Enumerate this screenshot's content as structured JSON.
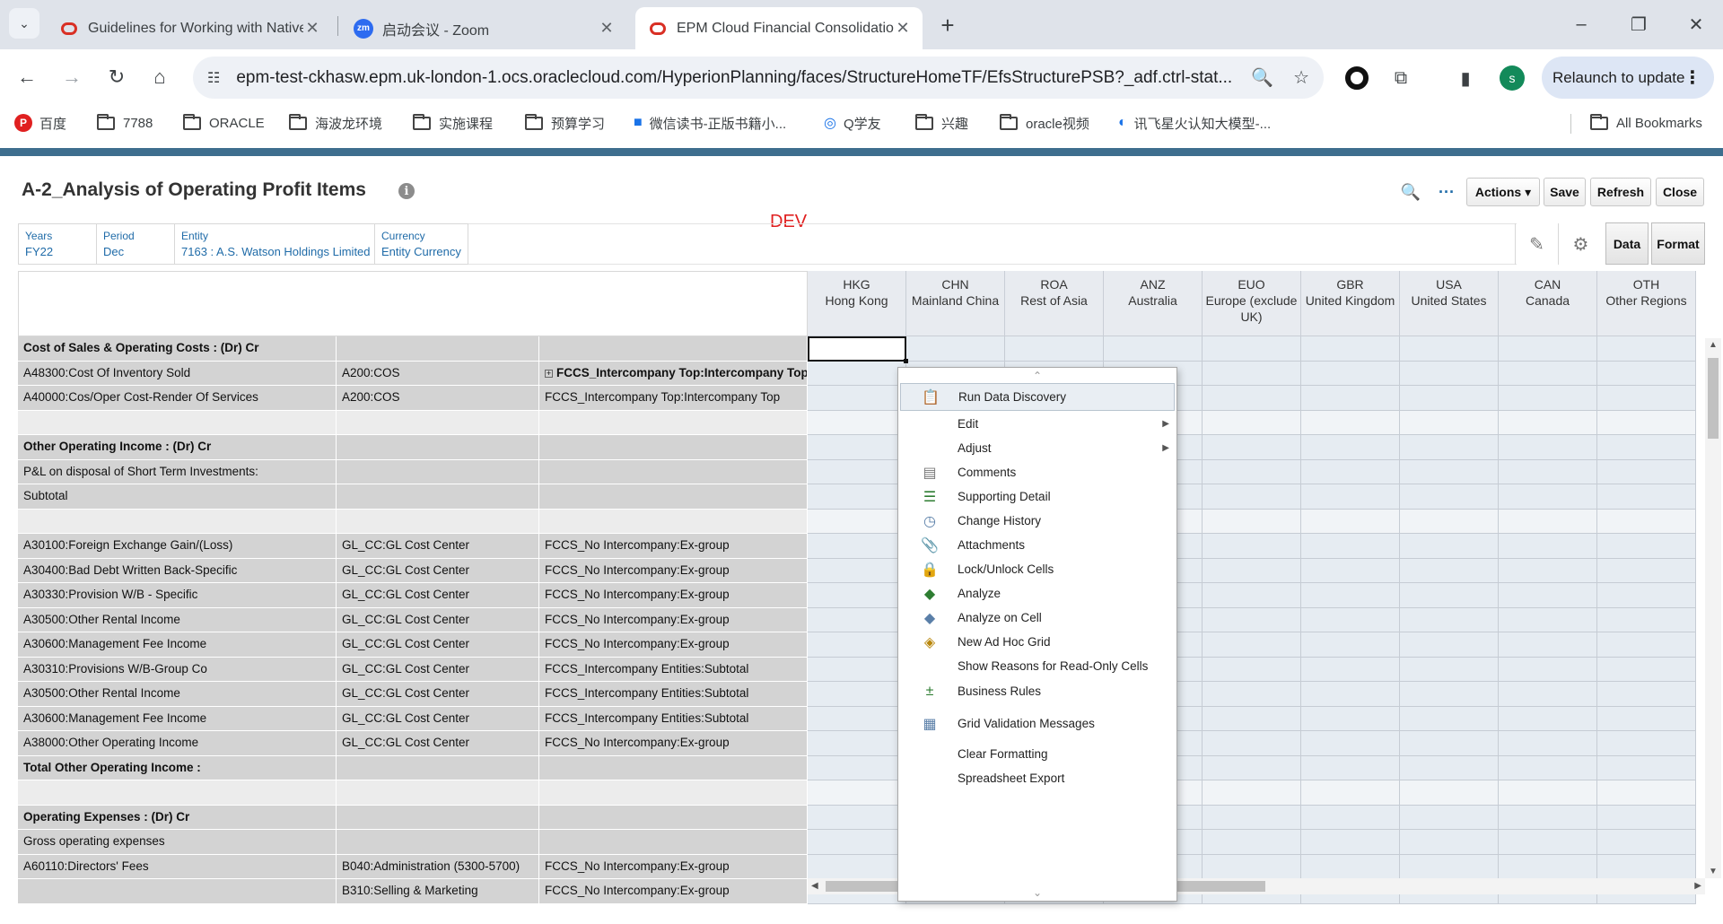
{
  "browser": {
    "tabs": [
      {
        "title": "Guidelines for Working with Native",
        "close": "✕"
      },
      {
        "title": "启动会议 - Zoom",
        "close": "✕"
      },
      {
        "title": "EPM Cloud Financial Consolidation",
        "close": "✕"
      }
    ],
    "zoom_badge": "zm",
    "new_tab": "+",
    "url": "epm-test-ckhasw.epm.uk-london-1.ocs.oraclecloud.com/HyperionPlanning/faces/StructureHomeTF/EfsStructurePSB?_adf.ctrl-stat...",
    "profile_initial": "s",
    "relaunch_label": "Relaunch to update",
    "bookmarks": [
      "百度",
      "7788",
      "ORACLE",
      "海波龙环境",
      "实施课程",
      "预算学习",
      "微信读书-正版书籍小...",
      "Q学友",
      "兴趣",
      "oracle视频",
      "讯飞星火认知大模型-..."
    ],
    "all_bookmarks": "All Bookmarks"
  },
  "app": {
    "title": "A-2_Analysis of Operating Profit Items",
    "env_label": "DEV",
    "buttons": {
      "actions": "Actions",
      "save": "Save",
      "refresh": "Refresh",
      "close": "Close"
    },
    "side_tabs": {
      "data": "Data",
      "format": "Format"
    },
    "pov": [
      {
        "dim": "Years",
        "value": "FY22"
      },
      {
        "dim": "Period",
        "value": "Dec"
      },
      {
        "dim": "Entity",
        "value": "7163 : A.S. Watson Holdings Limited"
      },
      {
        "dim": "Currency",
        "value": "Entity Currency"
      }
    ]
  },
  "grid": {
    "columns": [
      {
        "code": "HKG",
        "name": "Hong Kong"
      },
      {
        "code": "CHN",
        "name": "Mainland China"
      },
      {
        "code": "ROA",
        "name": "Rest of Asia"
      },
      {
        "code": "ANZ",
        "name": "Australia"
      },
      {
        "code": "EUO",
        "name": "Europe (exclude UK)"
      },
      {
        "code": "GBR",
        "name": "United Kingdom"
      },
      {
        "code": "USA",
        "name": "United States"
      },
      {
        "code": "CAN",
        "name": "Canada"
      },
      {
        "code": "OTH",
        "name": "Other Regions"
      }
    ],
    "rows": [
      {
        "c1": "Cost of Sales & Operating Costs : (Dr) Cr",
        "c2": "",
        "c3": "",
        "bold": true
      },
      {
        "c1": "A48300:Cost Of Inventory Sold",
        "c2": "A200:COS",
        "c3": "FCCS_Intercompany Top:Intercompany Top",
        "bold3": true,
        "expand": true
      },
      {
        "c1": "A40000:Cos/Oper Cost-Render Of Services",
        "c2": "A200:COS",
        "c3": "FCCS_Intercompany Top:Intercompany Top"
      },
      {
        "c1": "",
        "c2": "",
        "c3": "",
        "spacer": true
      },
      {
        "c1": "Other Operating Income : (Dr) Cr",
        "c2": "",
        "c3": "",
        "bold": true
      },
      {
        "c1": "P&L on disposal of Short Term Investments:",
        "c2": "",
        "c3": ""
      },
      {
        "c1": "Subtotal",
        "c2": "",
        "c3": ""
      },
      {
        "c1": "",
        "c2": "",
        "c3": "",
        "spacer": true
      },
      {
        "c1": "A30100:Foreign Exchange Gain/(Loss)",
        "c2": "GL_CC:GL Cost Center",
        "c3": "FCCS_No Intercompany:Ex-group"
      },
      {
        "c1": "A30400:Bad Debt Written Back-Specific",
        "c2": "GL_CC:GL Cost Center",
        "c3": "FCCS_No Intercompany:Ex-group"
      },
      {
        "c1": "A30330:Provision W/B - Specific",
        "c2": "GL_CC:GL Cost Center",
        "c3": "FCCS_No Intercompany:Ex-group"
      },
      {
        "c1": "A30500:Other Rental Income",
        "c2": "GL_CC:GL Cost Center",
        "c3": "FCCS_No Intercompany:Ex-group"
      },
      {
        "c1": "A30600:Management Fee Income",
        "c2": "GL_CC:GL Cost Center",
        "c3": "FCCS_No Intercompany:Ex-group"
      },
      {
        "c1": "A30310:Provisions W/B-Group Co",
        "c2": "GL_CC:GL Cost Center",
        "c3": "FCCS_Intercompany Entities:Subtotal"
      },
      {
        "c1": "A30500:Other Rental Income",
        "c2": "GL_CC:GL Cost Center",
        "c3": "FCCS_Intercompany Entities:Subtotal"
      },
      {
        "c1": "A30600:Management Fee Income",
        "c2": "GL_CC:GL Cost Center",
        "c3": "FCCS_Intercompany Entities:Subtotal"
      },
      {
        "c1": "A38000:Other Operating Income",
        "c2": "GL_CC:GL Cost Center",
        "c3": "FCCS_No Intercompany:Ex-group"
      },
      {
        "c1": "Total Other Operating Income :",
        "c2": "",
        "c3": "",
        "bold": true
      },
      {
        "c1": "",
        "c2": "",
        "c3": "",
        "spacer": true
      },
      {
        "c1": "Operating Expenses : (Dr) Cr",
        "c2": "",
        "c3": "",
        "bold": true
      },
      {
        "c1": "Gross operating expenses",
        "c2": "",
        "c3": ""
      },
      {
        "c1": "A60110:Directors' Fees",
        "c2": "B040:Administration (5300-5700)",
        "c3": "FCCS_No Intercompany:Ex-group"
      },
      {
        "c1": "",
        "c2": "B310:Selling & Marketing",
        "c3": "FCCS_No Intercompany:Ex-group"
      }
    ]
  },
  "context_menu": {
    "items": [
      {
        "label": "Run Data Discovery",
        "icon": "data-discovery-icon",
        "glyph": "📋",
        "highlight": true
      },
      {
        "label": "Edit",
        "icon": "",
        "glyph": "",
        "submenu": true
      },
      {
        "label": "Adjust",
        "icon": "",
        "glyph": "",
        "submenu": true
      },
      {
        "label": "Comments",
        "icon": "comments-icon",
        "glyph": "▤"
      },
      {
        "label": "Supporting Detail",
        "icon": "supporting-detail-icon",
        "glyph": "☰"
      },
      {
        "label": "Change History",
        "icon": "change-history-icon",
        "glyph": "◷"
      },
      {
        "label": "Attachments",
        "icon": "attachments-icon",
        "glyph": "📎"
      },
      {
        "label": "Lock/Unlock Cells",
        "icon": "lock-icon",
        "glyph": "🔒"
      },
      {
        "label": "Analyze",
        "icon": "analyze-icon",
        "glyph": "◆"
      },
      {
        "label": "Analyze on Cell",
        "icon": "analyze-cell-icon",
        "glyph": "◆"
      },
      {
        "label": "New Ad Hoc Grid",
        "icon": "adhoc-grid-icon",
        "glyph": "◈"
      },
      {
        "label": "Show Reasons for Read-Only Cells",
        "icon": "",
        "glyph": ""
      },
      {
        "label": "Business Rules",
        "icon": "business-rules-icon",
        "glyph": "±"
      },
      {
        "label": "Grid Validation Messages",
        "icon": "grid-validation-icon",
        "glyph": "▦"
      },
      {
        "label": "Clear Formatting",
        "icon": "",
        "glyph": ""
      },
      {
        "label": "Spreadsheet Export",
        "icon": "",
        "glyph": ""
      }
    ]
  }
}
